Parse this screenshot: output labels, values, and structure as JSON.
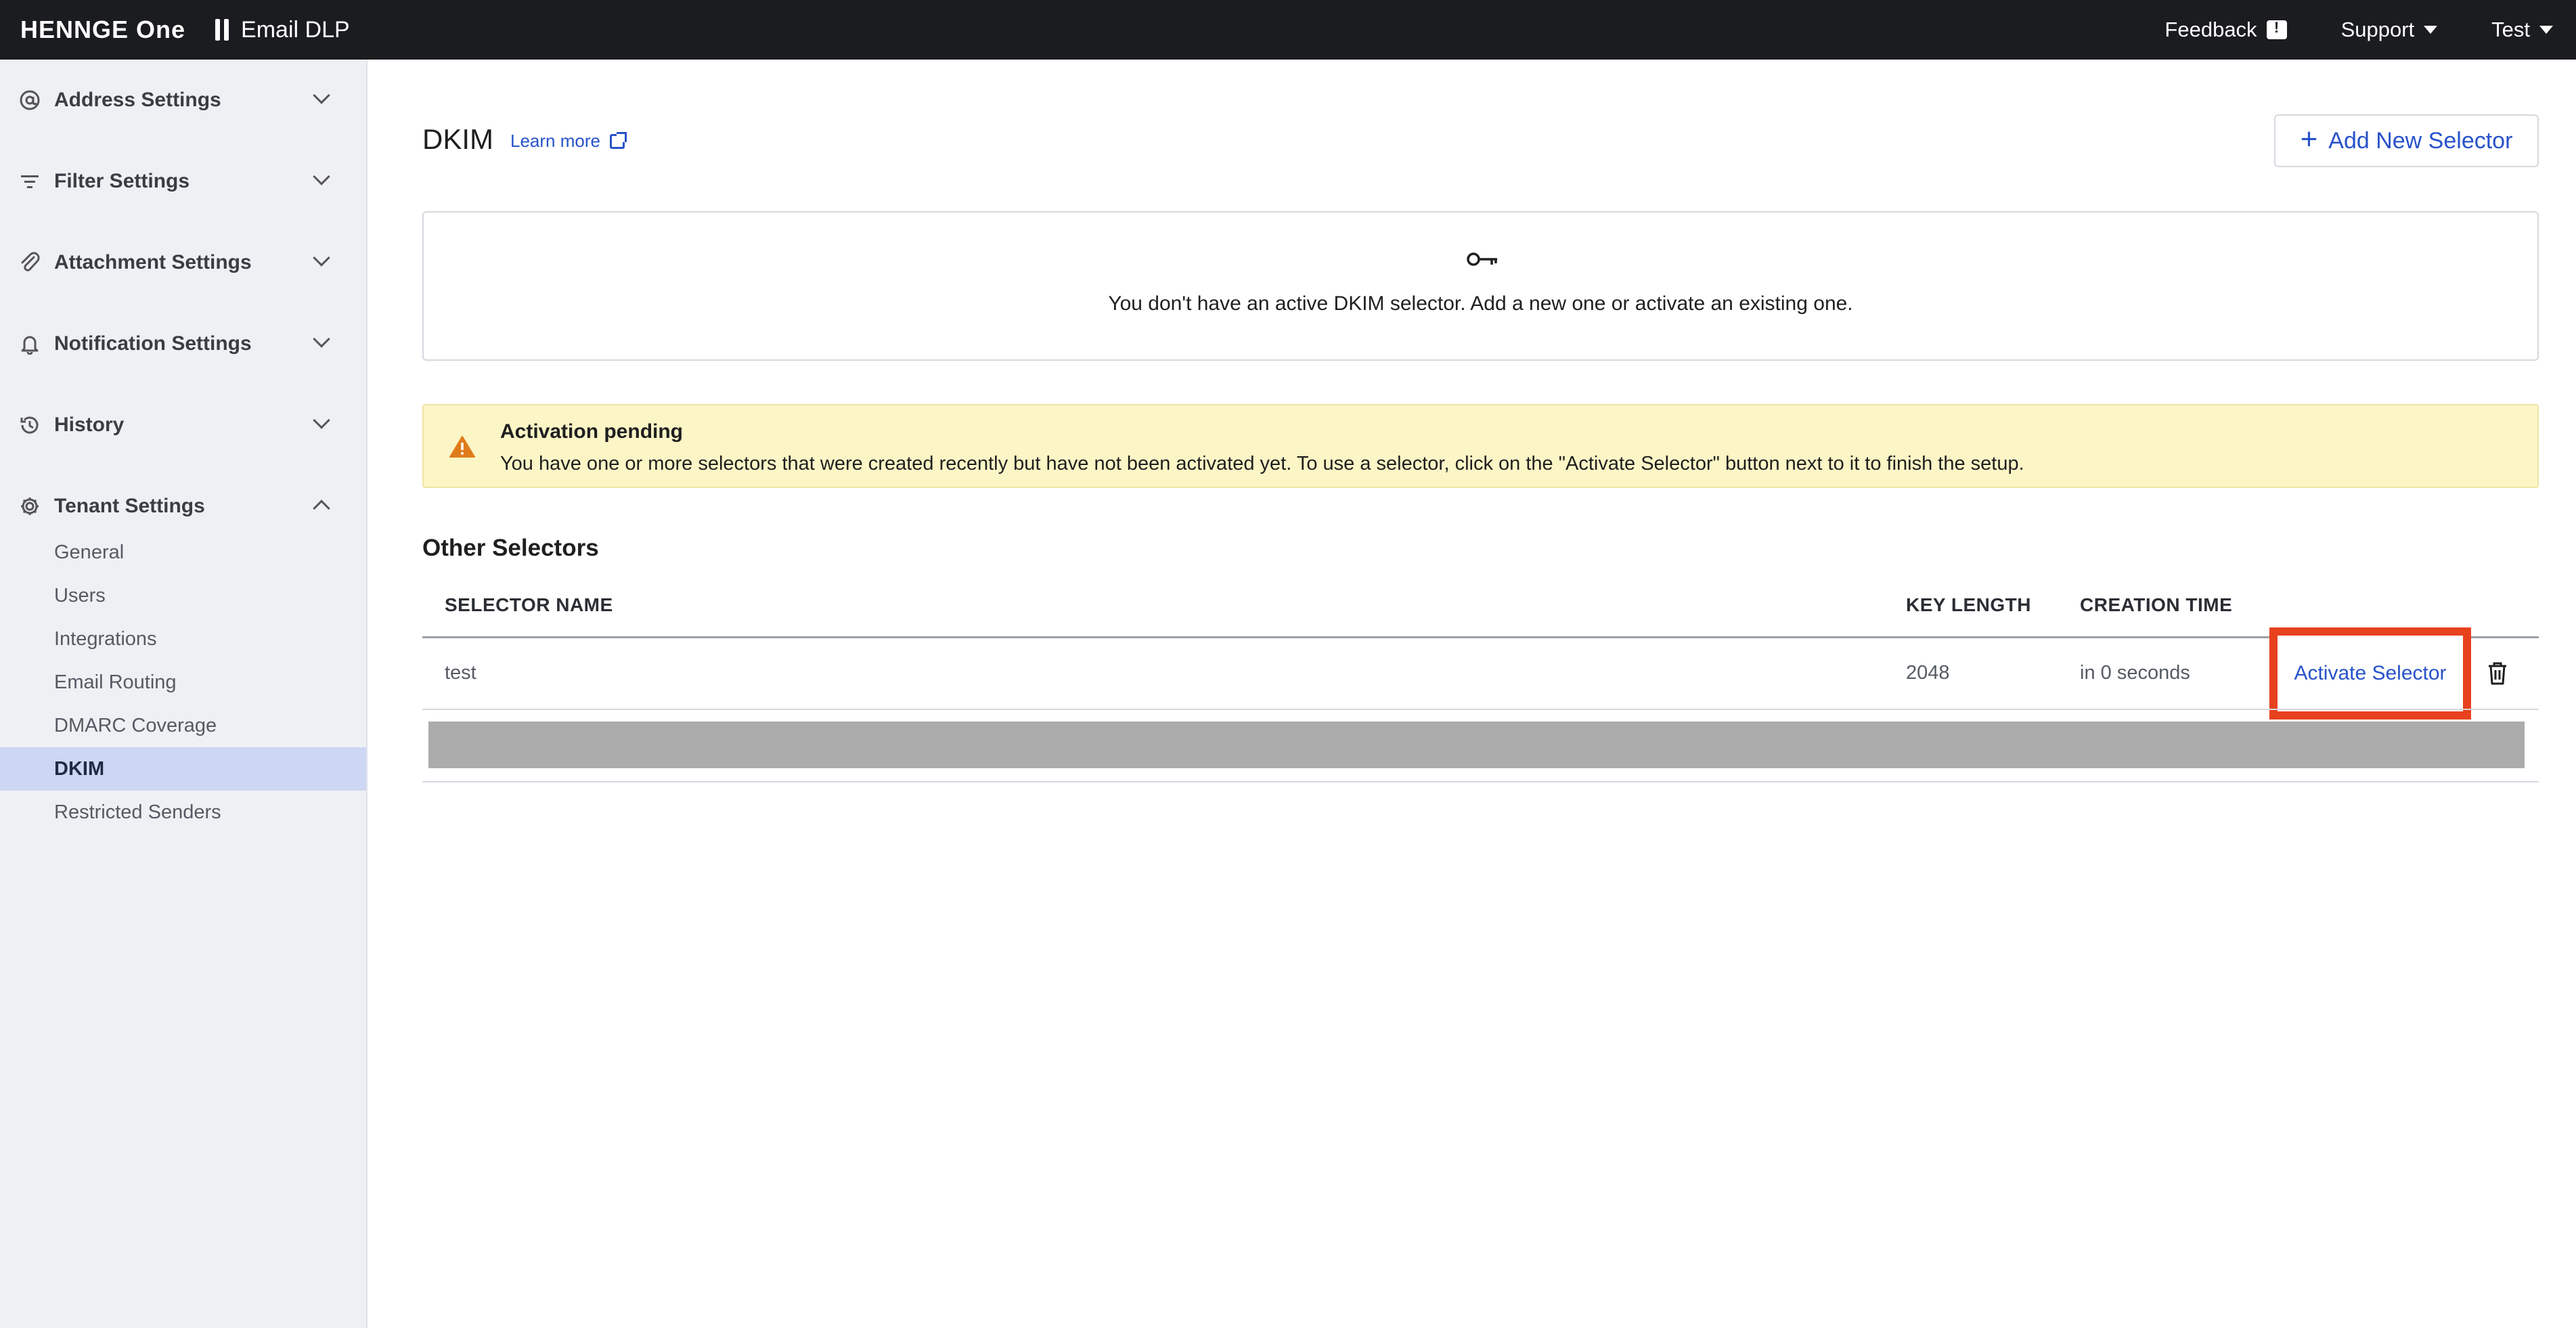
{
  "topbar": {
    "brand": "HENNGE One",
    "product": "Email DLP",
    "feedback_label": "Feedback",
    "support_label": "Support",
    "user_label": "Test"
  },
  "sidebar": {
    "groups": [
      {
        "label": "Address Settings",
        "icon": "at-icon",
        "expanded": false
      },
      {
        "label": "Filter Settings",
        "icon": "filter-icon",
        "expanded": false
      },
      {
        "label": "Attachment Settings",
        "icon": "paperclip-icon",
        "expanded": false
      },
      {
        "label": "Notification Settings",
        "icon": "bell-icon",
        "expanded": false
      },
      {
        "label": "History",
        "icon": "history-icon",
        "expanded": false
      },
      {
        "label": "Tenant Settings",
        "icon": "gear-icon",
        "expanded": true
      }
    ],
    "sub_items": [
      {
        "label": "General",
        "active": false
      },
      {
        "label": "Users",
        "active": false
      },
      {
        "label": "Integrations",
        "active": false
      },
      {
        "label": "Email Routing",
        "active": false
      },
      {
        "label": "DMARC Coverage",
        "active": false
      },
      {
        "label": "DKIM",
        "active": true
      },
      {
        "label": "Restricted Senders",
        "active": false
      }
    ]
  },
  "main": {
    "title": "DKIM",
    "learn_more": "Learn more",
    "add_button": "Add New Selector",
    "empty_message": "You don't have an active DKIM selector. Add a new one or activate an existing one.",
    "alert": {
      "title": "Activation pending",
      "body": "You have one or more selectors that were created recently but have not been activated yet. To use a selector, click on the \"Activate Selector\" button next to it to finish the setup."
    },
    "section_title": "Other Selectors",
    "table": {
      "headers": [
        "SELECTOR NAME",
        "KEY LENGTH",
        "CREATION TIME"
      ],
      "rows": [
        {
          "name": "test",
          "key_length": "2048",
          "creation_time": "in 0 seconds",
          "action": "Activate Selector"
        }
      ]
    }
  },
  "colors": {
    "accent": "#2752c9",
    "highlight": "#e8411e",
    "alert_bg": "#fcf5c6",
    "topbar_bg": "#1b1c1f",
    "sidebar_active": "#cdd6f2"
  }
}
